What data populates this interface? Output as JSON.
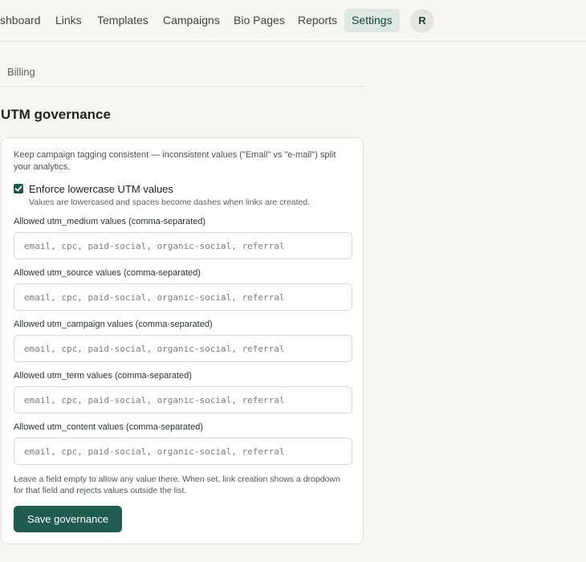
{
  "nav": {
    "items": [
      {
        "label": "shboard"
      },
      {
        "label": "Links"
      },
      {
        "label": "Templates"
      },
      {
        "label": "Campaigns"
      },
      {
        "label": "Bio Pages"
      },
      {
        "label": "Reports"
      },
      {
        "label": "Settings",
        "active": true
      }
    ],
    "avatar_initial": "R"
  },
  "subtabs": {
    "billing": "Billing"
  },
  "page": {
    "title": "UTM governance"
  },
  "card": {
    "intro": "Keep campaign tagging consistent — inconsistent values (\"Email\" vs \"e-mail\") split your analytics.",
    "enforce": {
      "checked": true,
      "label": "Enforce lowercase UTM values",
      "help": "Values are lowercased and spaces become dashes when links are created."
    },
    "fields": [
      {
        "label": "Allowed utm_medium values (comma-separated)",
        "value": "",
        "placeholder": "email, cpc, paid-social, organic-social, referral"
      },
      {
        "label": "Allowed utm_source values (comma-separated)",
        "value": "",
        "placeholder": "email, cpc, paid-social, organic-social, referral"
      },
      {
        "label": "Allowed utm_campaign values (comma-separated)",
        "value": "",
        "placeholder": "email, cpc, paid-social, organic-social, referral"
      },
      {
        "label": "Allowed utm_term values (comma-separated)",
        "value": "",
        "placeholder": "email, cpc, paid-social, organic-social, referral"
      },
      {
        "label": "Allowed utm_content values (comma-separated)",
        "value": "",
        "placeholder": "email, cpc, paid-social, organic-social, referral"
      }
    ],
    "footnote": "Leave a field empty to allow any value there. When set, link creation shows a dropdown for that field and rejects values outside the list.",
    "save_label": "Save governance"
  },
  "colors": {
    "accent": "#1d5c4f",
    "active_tab_bg": "#dde8e3",
    "page_bg": "#f7f6f3"
  }
}
